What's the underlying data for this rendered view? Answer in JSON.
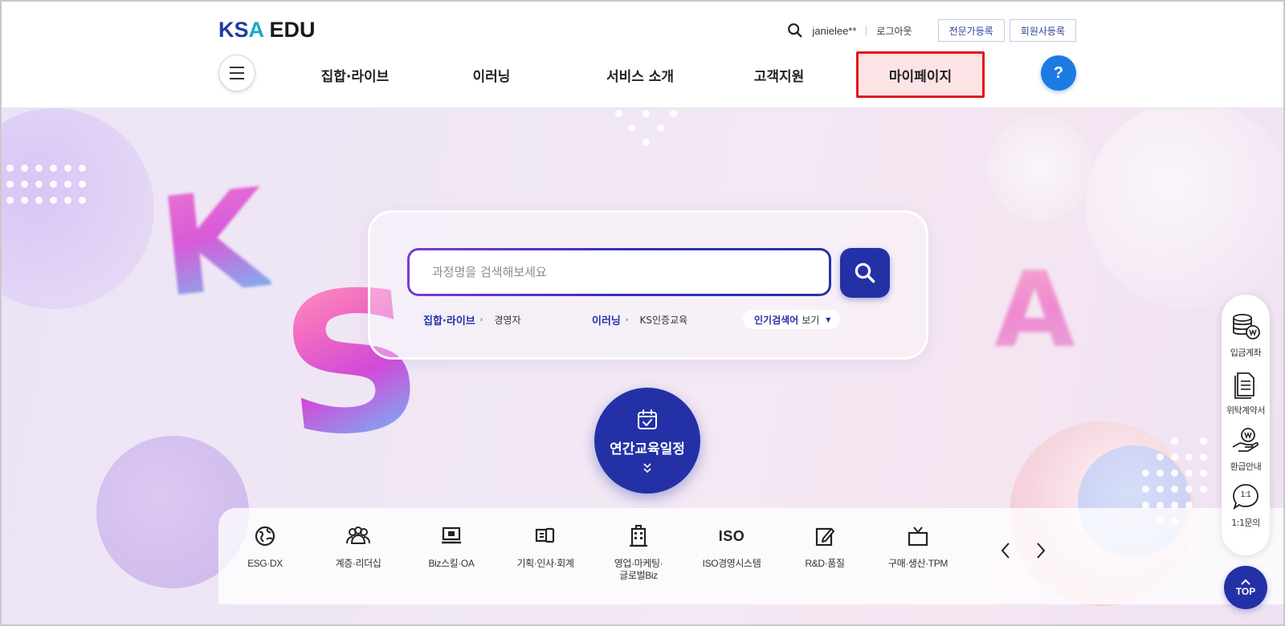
{
  "header": {
    "logo": {
      "part1": "KS",
      "part2": "A",
      "part3": " EDU"
    },
    "user_name": "janielee**",
    "logout_label": "로그아웃",
    "expert_register_label": "전문가등록",
    "member_company_register_label": "회원사등록",
    "help_label": "?"
  },
  "nav": {
    "items": [
      {
        "label": "집합·라이브",
        "active": false
      },
      {
        "label": "이러닝",
        "active": false
      },
      {
        "label": "서비스 소개",
        "active": false
      },
      {
        "label": "고객지원",
        "active": false
      },
      {
        "label": "마이페이지",
        "active": true
      }
    ]
  },
  "hero": {
    "letters": [
      "K",
      "S",
      "A"
    ],
    "search": {
      "placeholder": "과정명을 검색해보세요",
      "value": ""
    },
    "quick_links": [
      {
        "category": "집합·라이브",
        "keyword": "경영자"
      },
      {
        "category": "이러닝",
        "keyword": "KS인증교육"
      }
    ],
    "popular": {
      "label": "인기검색어",
      "action": "보기"
    },
    "annual_schedule_label": "연간교육일정"
  },
  "categories": [
    {
      "label": "ESG·DX",
      "icon": "globe-icon"
    },
    {
      "label": "계층·리더십",
      "icon": "people-group-icon"
    },
    {
      "label": "Biz스킬·OA",
      "icon": "monitor-icon"
    },
    {
      "label": "기획·인사·회계",
      "icon": "devices-icon"
    },
    {
      "label": "영업·마케팅·",
      "label2": "글로벌Biz",
      "icon": "building-icon"
    },
    {
      "label": "ISO경영시스템",
      "icon": "iso-icon",
      "icon_text": "ISO"
    },
    {
      "label": "R&D·품질",
      "icon": "edit-icon"
    },
    {
      "label": "구매·생산·TPM",
      "icon": "tv-icon"
    }
  ],
  "side_menu": [
    {
      "label": "입금계좌",
      "icon": "coin-stack-icon"
    },
    {
      "label": "위탁계약서",
      "icon": "document-icon"
    },
    {
      "label": "환급안내",
      "icon": "refund-hand-icon"
    },
    {
      "label": "1:1문의",
      "icon": "chat-bubble-icon",
      "icon_text": "1:1"
    }
  ],
  "top_button_label": "TOP",
  "colors": {
    "brand_navy": "#2431a6",
    "brand_cyan": "#19a7c9",
    "help_blue": "#1c7be3",
    "active_highlight_border": "#e4141b",
    "active_highlight_fill": "#fde3e6"
  }
}
